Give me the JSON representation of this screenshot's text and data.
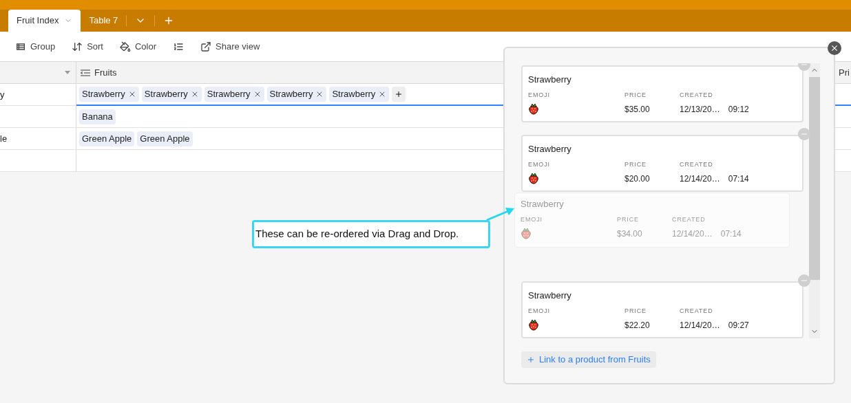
{
  "tabs": [
    {
      "label": "Fruit Index",
      "selected": true
    },
    {
      "label": "Table 7",
      "selected": false
    }
  ],
  "toolbar": [
    {
      "kind": "group",
      "label": "Group"
    },
    {
      "kind": "sort",
      "label": "Sort"
    },
    {
      "kind": "color",
      "label": "Color"
    },
    {
      "kind": "row-height"
    },
    {
      "kind": "share",
      "label": "Share view"
    }
  ],
  "table": {
    "fruits_header": "Fruits",
    "column_3_header": "Pri",
    "rows": [
      {
        "column_1": "y",
        "fruits": [
          "Strawberry",
          "Strawberry",
          "Strawberry",
          "Strawberry",
          "Strawberry"
        ],
        "selected": true
      },
      {
        "fruits": [
          "Banana"
        ],
        "selected": false
      },
      {
        "column_1": "le",
        "fruits": [
          "Green Apple",
          "Green Apple"
        ],
        "selected": false
      },
      {
        "fruits": [],
        "selected": false
      }
    ]
  },
  "dialog": {
    "records": [
      {
        "kind": "record",
        "title": "Strawberry",
        "emoji_label": "EMOJI",
        "price_label": "PRICE",
        "created_label": "CREATED",
        "price": "$35.00",
        "date": "12/13/20…",
        "time": "09:12"
      },
      {
        "kind": "record",
        "title": "Strawberry",
        "emoji_label": "EMOJI",
        "price_label": "PRICE",
        "created_label": "CREATED",
        "price": "$20.00",
        "date": "12/14/20…",
        "time": "07:14"
      },
      {
        "kind": "drop-slot"
      },
      {
        "kind": "record",
        "title": "Strawberry",
        "emoji_label": "EMOJI",
        "price_label": "PRICE",
        "created_label": "CREATED",
        "price": "$22.20",
        "date": "12/14/20…",
        "time": "09:27"
      }
    ],
    "dragged": {
      "title": "Strawberry",
      "emoji_label": "EMOJI",
      "price_label": "PRICE",
      "created_label": "CREATED",
      "price": "$34.00",
      "date": "12/14/20…",
      "time": "07:14"
    },
    "link_button": "Link to a product from Fruits"
  },
  "annotation": "These can be re-ordered via Drag and Drop."
}
